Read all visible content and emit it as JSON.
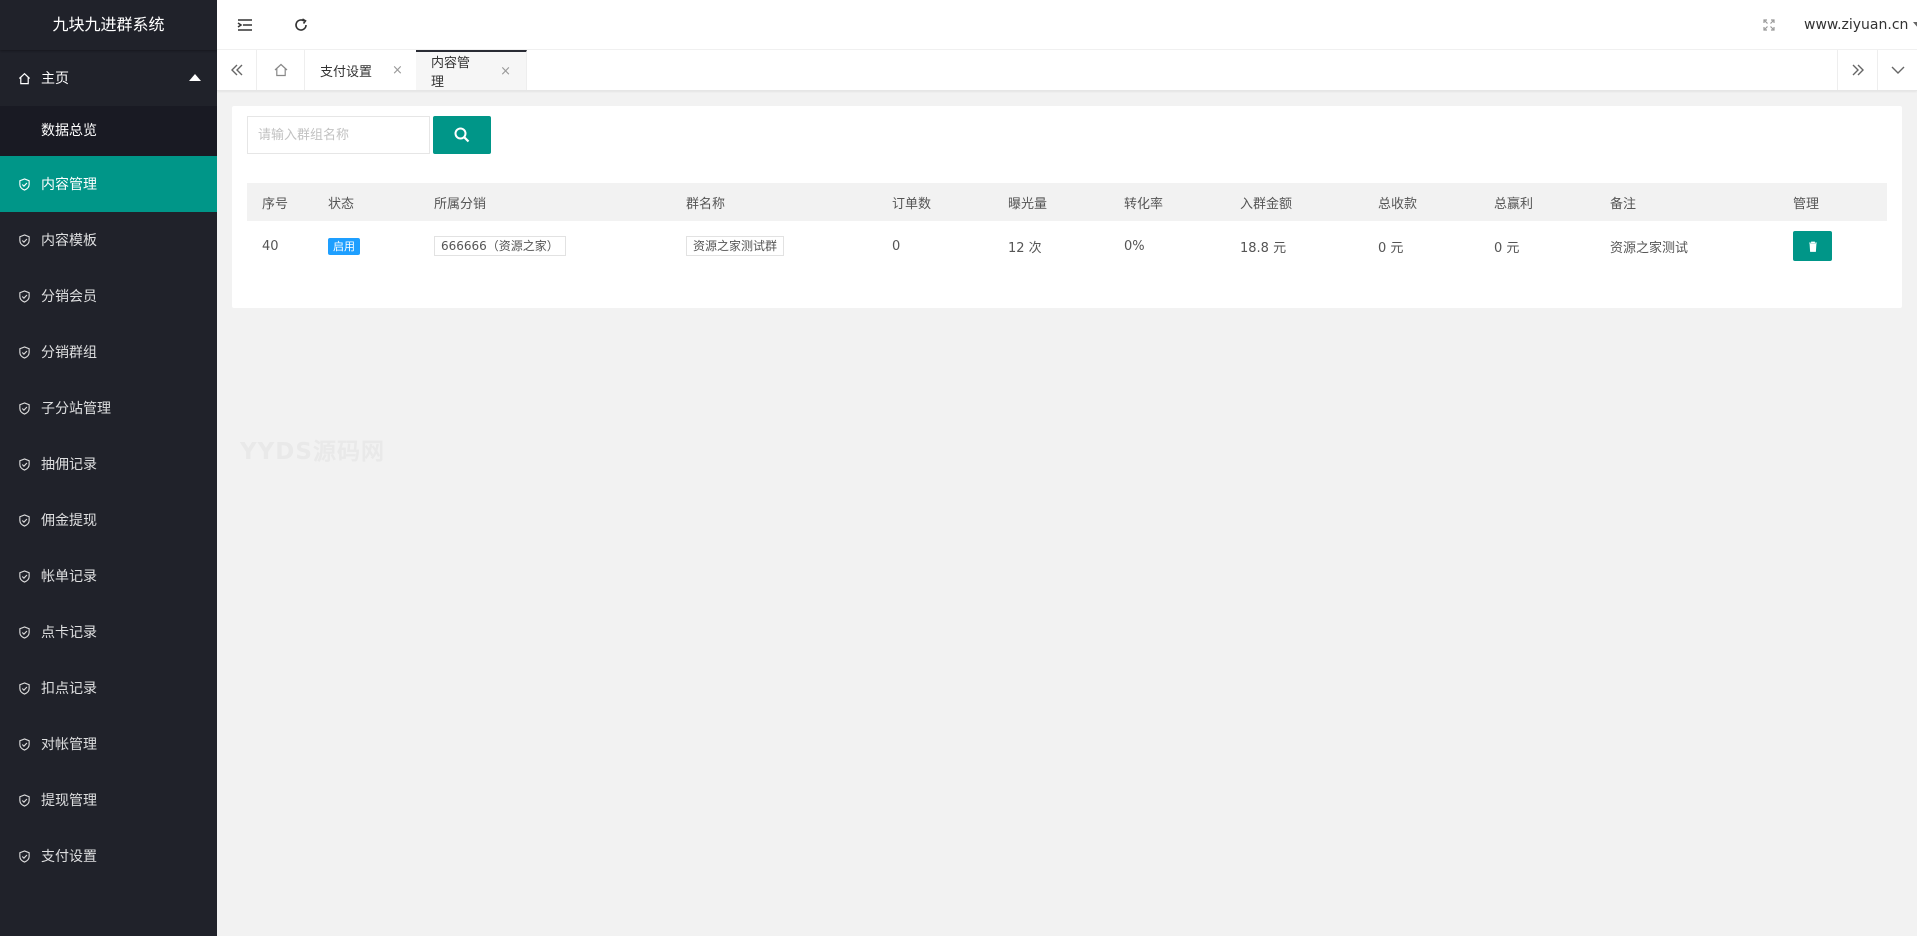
{
  "app": {
    "title": "九块九进群系统"
  },
  "sidebar": {
    "home": {
      "label": "主页"
    },
    "home_sub": {
      "label": "数据总览"
    },
    "items": [
      {
        "label": "内容管理",
        "active": true
      },
      {
        "label": "内容模板"
      },
      {
        "label": "分销会员"
      },
      {
        "label": "分销群组"
      },
      {
        "label": "子分站管理"
      },
      {
        "label": "抽佣记录"
      },
      {
        "label": "佣金提现"
      },
      {
        "label": "帐单记录"
      },
      {
        "label": "点卡记录"
      },
      {
        "label": "扣点记录"
      },
      {
        "label": "对帐管理"
      },
      {
        "label": "提现管理"
      },
      {
        "label": "支付设置"
      }
    ]
  },
  "header": {
    "user": "www.ziyuan.cn"
  },
  "tabs": {
    "items": [
      {
        "label": "支付设置",
        "close": "×"
      },
      {
        "label": "内容管理",
        "close": "×",
        "active": true
      }
    ]
  },
  "search": {
    "placeholder": "请输入群组名称"
  },
  "table": {
    "headers": [
      "序号",
      "状态",
      "所属分销",
      "群名称",
      "订单数",
      "曝光量",
      "转化率",
      "入群金额",
      "总收款",
      "总赢利",
      "备注",
      "管理"
    ],
    "rows": [
      {
        "id": "40",
        "status": "启用",
        "distributor": "666666（资源之家）",
        "group_name": "资源之家测试群",
        "orders": "0",
        "exposure": "12 次",
        "conversion": "0%",
        "entry_amount": "18.8 元",
        "total_received": "0 元",
        "total_profit": "0 元",
        "note": "资源之家测试"
      }
    ]
  },
  "watermark": "YYDS源码网",
  "colors": {
    "accent": "#009688",
    "sidebar": "#20222a",
    "badge": "#1e9fff"
  }
}
